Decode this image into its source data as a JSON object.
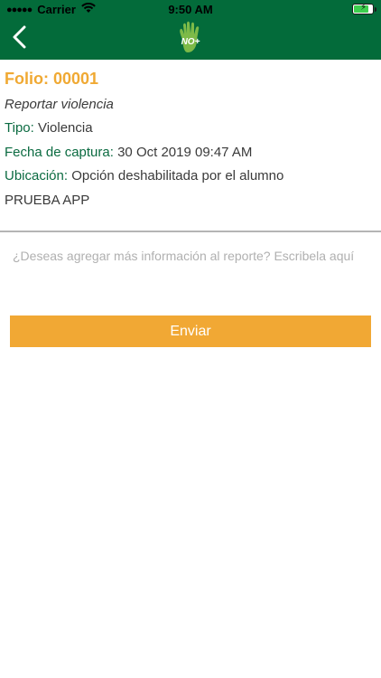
{
  "status_bar": {
    "carrier": "Carrier",
    "time": "9:50 AM"
  },
  "header": {
    "logo_text": "NO+",
    "back_icon": "chevron-left-icon",
    "color": "#036b3a"
  },
  "report": {
    "folio_label": "Folio: 00001",
    "subtitle": "Reportar violencia",
    "tipo_label": "Tipo:",
    "tipo_value": " Violencia",
    "fecha_label": "Fecha de captura:",
    "fecha_value": " 30 Oct 2019 09:47 AM",
    "ubicacion_label": "Ubicación:",
    "ubicacion_value": " Opción deshabilitada por el alumno",
    "note": "PRUEBA APP"
  },
  "form": {
    "placeholder": "¿Deseas agregar más información al reporte? Escribela aquí",
    "send_label": "Enviar"
  },
  "colors": {
    "accent": "#f1a834",
    "green": "#0b6b41"
  }
}
